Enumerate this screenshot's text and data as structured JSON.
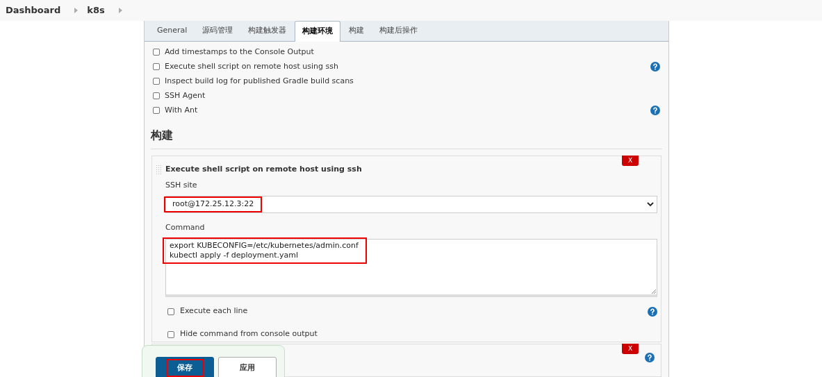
{
  "breadcrumbs": [
    {
      "label": "Dashboard"
    },
    {
      "label": "k8s"
    }
  ],
  "tabs": [
    {
      "label": "General",
      "selected": false
    },
    {
      "label": "源码管理",
      "selected": false
    },
    {
      "label": "构建触发器",
      "selected": false
    },
    {
      "label": "构建环境",
      "selected": true
    },
    {
      "label": "构建",
      "selected": false
    },
    {
      "label": "构建后操作",
      "selected": false
    }
  ],
  "environment_options": [
    {
      "label": "Add timestamps to the Console Output",
      "checked": false,
      "help": false
    },
    {
      "label": "Execute shell script on remote host using ssh",
      "checked": false,
      "help": true
    },
    {
      "label": "Inspect build log for published Gradle build scans",
      "checked": false,
      "help": false
    },
    {
      "label": "SSH Agent",
      "checked": false,
      "help": false
    },
    {
      "label": "With Ant",
      "checked": false,
      "help": true
    }
  ],
  "build_section": {
    "heading": "构建",
    "step": {
      "title": "Execute shell script on remote host using ssh",
      "delete_label": "X",
      "ssh_site": {
        "label": "SSH site",
        "value": "root@172.25.12.3:22",
        "highlighted": true
      },
      "command": {
        "label": "Command",
        "lines": [
          "export KUBECONFIG=/etc/kubernetes/admin.conf",
          "kubectl apply -f deployment.yaml"
        ],
        "highlighted": true
      },
      "options": [
        {
          "label": "Execute each line",
          "checked": false,
          "help": true
        },
        {
          "label": "Hide command from console output",
          "checked": false,
          "help": false
        }
      ]
    },
    "next_step": {
      "delete_label": "X"
    }
  },
  "buttons": [
    {
      "label": "保存",
      "kind": "primary",
      "highlighted": true
    },
    {
      "label": "应用",
      "kind": "secondary",
      "highlighted": false
    }
  ]
}
